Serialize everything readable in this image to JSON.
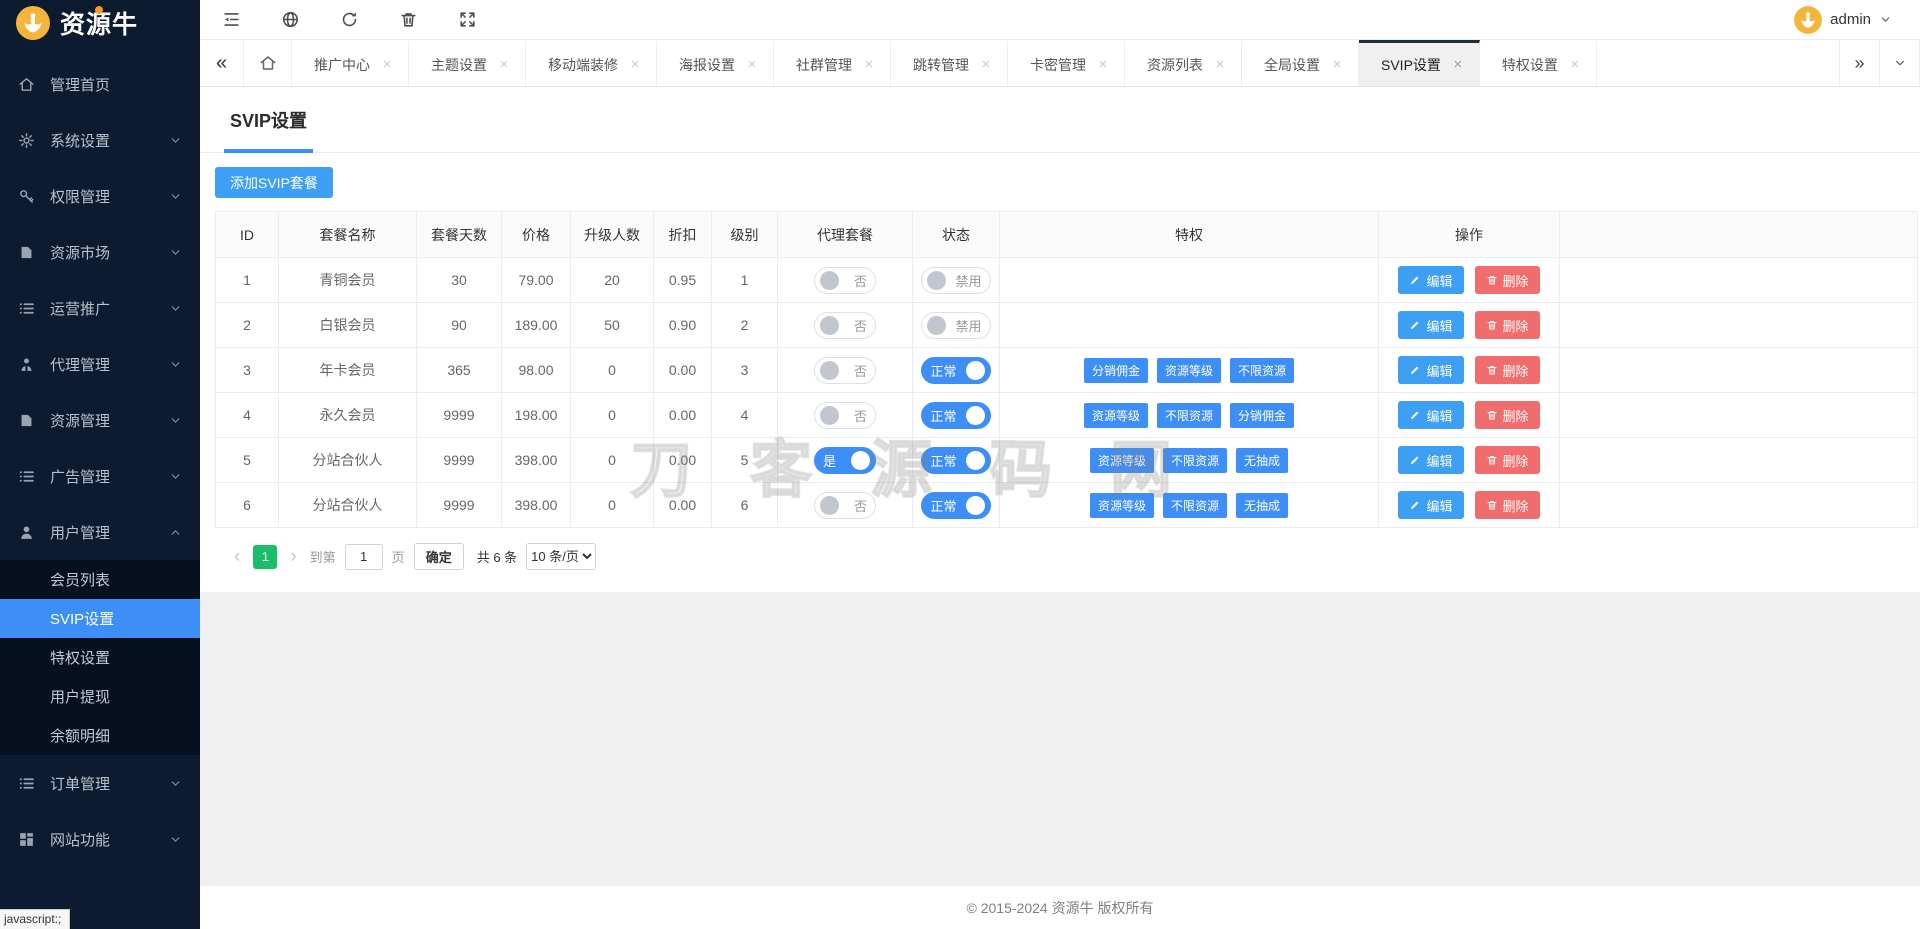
{
  "logo": {
    "title": "资源牛"
  },
  "topbar": {
    "user": "admin"
  },
  "icons": {
    "close_glyph": "×",
    "back_double": "«",
    "forward_double": "»",
    "prev": "‹",
    "next": "›"
  },
  "sidebar": {
    "items": [
      {
        "label": "管理首页",
        "icon": "home",
        "chevron": null
      },
      {
        "label": "系统设置",
        "icon": "gear",
        "chevron": "down"
      },
      {
        "label": "权限管理",
        "icon": "key",
        "chevron": "down"
      },
      {
        "label": "资源市场",
        "icon": "bag",
        "chevron": "down"
      },
      {
        "label": "运营推广",
        "icon": "list",
        "chevron": "down"
      },
      {
        "label": "代理管理",
        "icon": "agent",
        "chevron": "down"
      },
      {
        "label": "资源管理",
        "icon": "bag",
        "chevron": "down"
      },
      {
        "label": "广告管理",
        "icon": "list",
        "chevron": "down"
      },
      {
        "label": "用户管理",
        "icon": "user",
        "chevron": "up",
        "expanded": true,
        "children": [
          {
            "label": "会员列表",
            "active": false
          },
          {
            "label": "SVIP设置",
            "active": true
          },
          {
            "label": "特权设置",
            "active": false
          },
          {
            "label": "用户提现",
            "active": false
          },
          {
            "label": "余额明细",
            "active": false
          }
        ]
      },
      {
        "label": "订单管理",
        "icon": "list",
        "chevron": "down"
      },
      {
        "label": "网站功能",
        "icon": "grid",
        "chevron": "down"
      }
    ]
  },
  "tabbar": {
    "tabs": [
      {
        "label": "推广中心",
        "active": false
      },
      {
        "label": "主题设置",
        "active": false
      },
      {
        "label": "移动端装修",
        "active": false
      },
      {
        "label": "海报设置",
        "active": false
      },
      {
        "label": "社群管理",
        "active": false
      },
      {
        "label": "跳转管理",
        "active": false
      },
      {
        "label": "卡密管理",
        "active": false
      },
      {
        "label": "资源列表",
        "active": false
      },
      {
        "label": "全局设置",
        "active": false
      },
      {
        "label": "SVIP设置",
        "active": true
      },
      {
        "label": "特权设置",
        "active": false
      }
    ]
  },
  "page": {
    "title": "SVIP设置",
    "add_button": "添加SVIP套餐"
  },
  "table": {
    "columns": [
      "ID",
      "套餐名称",
      "套餐天数",
      "价格",
      "升级人数",
      "折扣",
      "级别",
      "代理套餐",
      "状态",
      "特权",
      "操作"
    ],
    "edit_label": "编辑",
    "delete_label": "删除",
    "rows": [
      {
        "id": "1",
        "name": "青铜会员",
        "days": "30",
        "price": "79.00",
        "upgrade": "20",
        "discount": "0.95",
        "level": "1",
        "agent": {
          "on": false,
          "label": "否"
        },
        "status": {
          "on": false,
          "label": "禁用"
        },
        "privileges": []
      },
      {
        "id": "2",
        "name": "白银会员",
        "days": "90",
        "price": "189.00",
        "upgrade": "50",
        "discount": "0.90",
        "level": "2",
        "agent": {
          "on": false,
          "label": "否"
        },
        "status": {
          "on": false,
          "label": "禁用"
        },
        "privileges": []
      },
      {
        "id": "3",
        "name": "年卡会员",
        "days": "365",
        "price": "98.00",
        "upgrade": "0",
        "discount": "0.00",
        "level": "3",
        "agent": {
          "on": false,
          "label": "否"
        },
        "status": {
          "on": true,
          "label": "正常"
        },
        "privileges": [
          "分销佣金",
          "资源等级",
          "不限资源"
        ]
      },
      {
        "id": "4",
        "name": "永久会员",
        "days": "9999",
        "price": "198.00",
        "upgrade": "0",
        "discount": "0.00",
        "level": "4",
        "agent": {
          "on": false,
          "label": "否"
        },
        "status": {
          "on": true,
          "label": "正常"
        },
        "privileges": [
          "资源等级",
          "不限资源",
          "分销佣金"
        ]
      },
      {
        "id": "5",
        "name": "分站合伙人",
        "days": "9999",
        "price": "398.00",
        "upgrade": "0",
        "discount": "0.00",
        "level": "5",
        "agent": {
          "on": true,
          "label": "是"
        },
        "status": {
          "on": true,
          "label": "正常"
        },
        "privileges": [
          "资源等级",
          "不限资源",
          "无抽成"
        ]
      },
      {
        "id": "6",
        "name": "分站合伙人",
        "days": "9999",
        "price": "398.00",
        "upgrade": "0",
        "discount": "0.00",
        "level": "6",
        "agent": {
          "on": false,
          "label": "否"
        },
        "status": {
          "on": true,
          "label": "正常"
        },
        "privileges": [
          "资源等级",
          "不限资源",
          "无抽成"
        ]
      }
    ]
  },
  "pagination": {
    "current_page": "1",
    "goto_prefix": "到第",
    "goto_value": "1",
    "goto_suffix": "页",
    "confirm": "确定",
    "total": "共 6 条",
    "page_size": "10 条/页"
  },
  "footer": {
    "copyright": "© 2015-2024 资源牛 版权所有"
  },
  "watermark": "刀客源码网",
  "status_tooltip": "javascript:;",
  "colors": {
    "accent": "#3e8ef7",
    "button_blue": "#3da0f5",
    "danger": "#f16c6c",
    "green": "#19be6b",
    "sidebar_bg": "#0d1b30",
    "submenu_bg": "#071020",
    "active_tab_border": "#1f2c3e",
    "logo_yellow": "#f5b53a"
  }
}
